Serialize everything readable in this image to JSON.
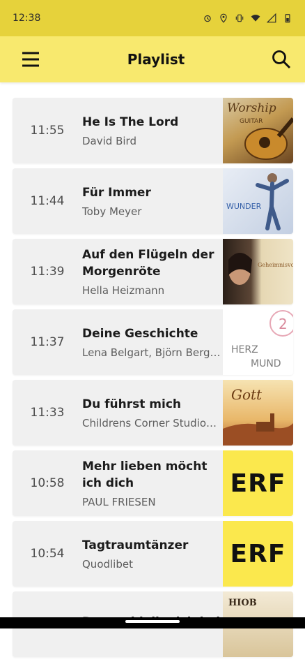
{
  "status": {
    "time": "12:38",
    "icons": [
      "alarm-icon",
      "location-icon",
      "vibrate-icon",
      "wifi-icon",
      "signal-icon",
      "battery-icon"
    ]
  },
  "appbar": {
    "title": "Playlist",
    "menu_icon": "menu-icon",
    "search_icon": "search-icon"
  },
  "colors": {
    "statusbar": "#e6d23b",
    "appbar": "#f8e96e",
    "erf_yellow": "#fbe84d"
  },
  "playlist": [
    {
      "time": "11:55",
      "title": "He Is The Lord",
      "artist": "David Bird",
      "cover": "worship-guitar-cover",
      "cover_text": "Worship",
      "cover_sub": "GUITAR"
    },
    {
      "time": "11:44",
      "title": "Für Immer",
      "artist": "Toby Meyer",
      "cover": "wunder-cover",
      "cover_text": "WUNDER"
    },
    {
      "time": "11:39",
      "title": "Auf den Flügeln der Morgenröte",
      "artist": "Hella Heizmann",
      "cover": "geheimnisvoll-cover",
      "cover_text": "Geheimnisvoll"
    },
    {
      "time": "11:37",
      "title": "Deine Geschichte",
      "artist": "Lena Belgart, Björn Berg…",
      "cover": "herz-mund-cover",
      "cover_text": "HERZ",
      "cover_sub": "MUND",
      "cover_num": "2"
    },
    {
      "time": "11:33",
      "title": "Du führst mich",
      "artist": "Childrens Corner Studio…",
      "cover": "gott-gross-cover",
      "cover_text": "Gott"
    },
    {
      "time": "10:58",
      "title": "Mehr lieben möcht ich dich",
      "artist": "PAUL FRIESEN",
      "cover": "erf-logo",
      "cover_text": "ERF"
    },
    {
      "time": "10:54",
      "title": "Tagtraumtänzer",
      "artist": "Quodlibet",
      "cover": "erf-logo",
      "cover_text": "ERF"
    },
    {
      "time": "",
      "title": "Darum bleibe ich bei",
      "artist": "",
      "cover": "hiob-cover",
      "cover_text": "HIOB"
    }
  ]
}
